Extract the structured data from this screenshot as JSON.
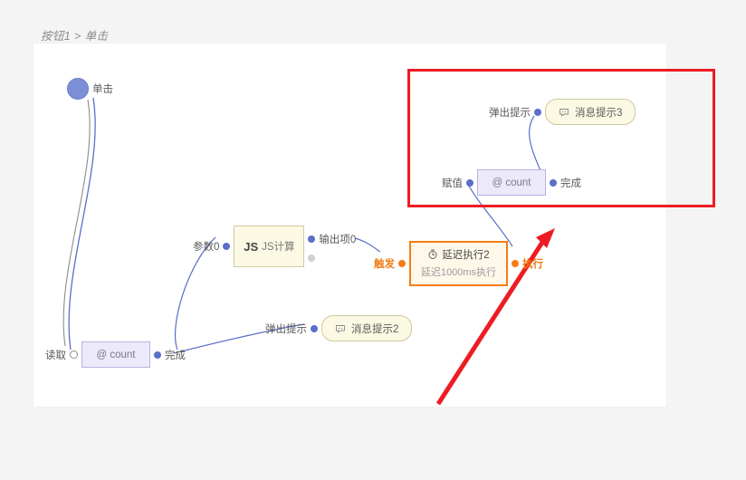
{
  "breadcrumb": {
    "text": "按钮1 > 单击"
  },
  "colors": {
    "page_background": "#f4f4f5",
    "canvas_background": "#ffffff",
    "wire_blue": "#5b6ec8",
    "wire_gray": "#8c8c8c",
    "accent_orange": "#f57c16",
    "annotation_red": "#ed1c24",
    "node_yellow_fill": "#fbf8e3",
    "node_purple_fill": "#eceafa",
    "port_blue": "#5b6ec8"
  },
  "nodes": {
    "start": {
      "label": "单击",
      "icon": "start-circle-icon"
    },
    "read_count": {
      "in_port": "读取",
      "in_port_icon": "hollow-circle-icon",
      "value": "@ count",
      "out_port": "完成"
    },
    "js": {
      "in_port": "参数0",
      "badge": "JS",
      "title": "JS计算",
      "out_port": "输出项0"
    },
    "delay": {
      "in_port": "触发",
      "icon": "clock-icon",
      "title": "延迟执行2",
      "subtitle": "延迟1000ms执行",
      "out_port": "执行"
    },
    "message2": {
      "in_port": "弹出提示",
      "icon": "chat-icon",
      "title": "消息提示2"
    },
    "message3": {
      "in_port": "弹出提示",
      "icon": "chat-icon",
      "title": "消息提示3"
    },
    "assign_count": {
      "in_port": "赋值",
      "value": "@ count",
      "out_port": "完成"
    }
  },
  "annotations": {
    "highlight_box": {
      "name": "red-highlight-rectangle"
    },
    "arrow": {
      "name": "red-pointer-arrow"
    }
  }
}
